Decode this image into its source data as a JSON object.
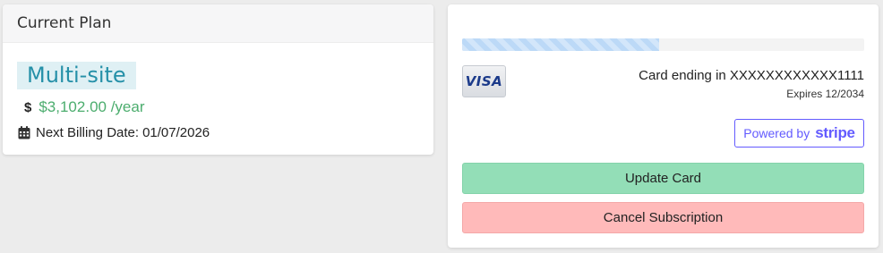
{
  "plan_card": {
    "header_title": "Current Plan",
    "plan_name": "Multi-site",
    "currency_symbol": "$",
    "price": "$3,102.00 /year",
    "billing_label": "Next Billing Date:",
    "billing_date": "01/07/2026"
  },
  "payment_card": {
    "progress_fraction": 0.49,
    "card_brand": "VISA",
    "card_ending": "Card ending in XXXXXXXXXXXX1111",
    "card_expiry": "Expires 12/2034",
    "powered_by": "Powered by",
    "stripe": "stripe",
    "update_button": "Update Card",
    "cancel_button": "Cancel Subscription"
  },
  "icons": {
    "dollar": "dollar-icon",
    "calendar": "calendar-icon",
    "visa": "visa-logo"
  },
  "colors": {
    "plan_badge_bg": "#dff0f4",
    "plan_badge_text": "#2590a8",
    "price_text": "#4cad6e",
    "stripe_accent": "#635bff",
    "update_button_bg": "#93deb7",
    "cancel_button_bg": "#ffbaba",
    "progress_fill": "#bcd9f7"
  }
}
